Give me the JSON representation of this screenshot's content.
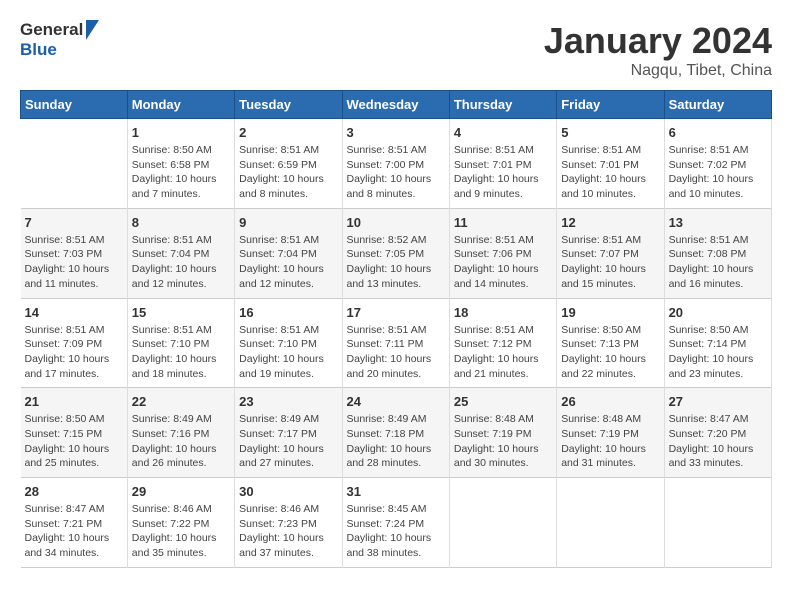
{
  "header": {
    "logo": {
      "general": "General",
      "blue": "Blue"
    },
    "title": "January 2024",
    "location": "Nagqu, Tibet, China"
  },
  "calendar": {
    "days_of_week": [
      "Sunday",
      "Monday",
      "Tuesday",
      "Wednesday",
      "Thursday",
      "Friday",
      "Saturday"
    ],
    "weeks": [
      [
        {
          "day": "",
          "info": ""
        },
        {
          "day": "1",
          "info": "Sunrise: 8:50 AM\nSunset: 6:58 PM\nDaylight: 10 hours\nand 7 minutes."
        },
        {
          "day": "2",
          "info": "Sunrise: 8:51 AM\nSunset: 6:59 PM\nDaylight: 10 hours\nand 8 minutes."
        },
        {
          "day": "3",
          "info": "Sunrise: 8:51 AM\nSunset: 7:00 PM\nDaylight: 10 hours\nand 8 minutes."
        },
        {
          "day": "4",
          "info": "Sunrise: 8:51 AM\nSunset: 7:01 PM\nDaylight: 10 hours\nand 9 minutes."
        },
        {
          "day": "5",
          "info": "Sunrise: 8:51 AM\nSunset: 7:01 PM\nDaylight: 10 hours\nand 10 minutes."
        },
        {
          "day": "6",
          "info": "Sunrise: 8:51 AM\nSunset: 7:02 PM\nDaylight: 10 hours\nand 10 minutes."
        }
      ],
      [
        {
          "day": "7",
          "info": "Sunrise: 8:51 AM\nSunset: 7:03 PM\nDaylight: 10 hours\nand 11 minutes."
        },
        {
          "day": "8",
          "info": "Sunrise: 8:51 AM\nSunset: 7:04 PM\nDaylight: 10 hours\nand 12 minutes."
        },
        {
          "day": "9",
          "info": "Sunrise: 8:51 AM\nSunset: 7:04 PM\nDaylight: 10 hours\nand 12 minutes."
        },
        {
          "day": "10",
          "info": "Sunrise: 8:52 AM\nSunset: 7:05 PM\nDaylight: 10 hours\nand 13 minutes."
        },
        {
          "day": "11",
          "info": "Sunrise: 8:51 AM\nSunset: 7:06 PM\nDaylight: 10 hours\nand 14 minutes."
        },
        {
          "day": "12",
          "info": "Sunrise: 8:51 AM\nSunset: 7:07 PM\nDaylight: 10 hours\nand 15 minutes."
        },
        {
          "day": "13",
          "info": "Sunrise: 8:51 AM\nSunset: 7:08 PM\nDaylight: 10 hours\nand 16 minutes."
        }
      ],
      [
        {
          "day": "14",
          "info": "Sunrise: 8:51 AM\nSunset: 7:09 PM\nDaylight: 10 hours\nand 17 minutes."
        },
        {
          "day": "15",
          "info": "Sunrise: 8:51 AM\nSunset: 7:10 PM\nDaylight: 10 hours\nand 18 minutes."
        },
        {
          "day": "16",
          "info": "Sunrise: 8:51 AM\nSunset: 7:10 PM\nDaylight: 10 hours\nand 19 minutes."
        },
        {
          "day": "17",
          "info": "Sunrise: 8:51 AM\nSunset: 7:11 PM\nDaylight: 10 hours\nand 20 minutes."
        },
        {
          "day": "18",
          "info": "Sunrise: 8:51 AM\nSunset: 7:12 PM\nDaylight: 10 hours\nand 21 minutes."
        },
        {
          "day": "19",
          "info": "Sunrise: 8:50 AM\nSunset: 7:13 PM\nDaylight: 10 hours\nand 22 minutes."
        },
        {
          "day": "20",
          "info": "Sunrise: 8:50 AM\nSunset: 7:14 PM\nDaylight: 10 hours\nand 23 minutes."
        }
      ],
      [
        {
          "day": "21",
          "info": "Sunrise: 8:50 AM\nSunset: 7:15 PM\nDaylight: 10 hours\nand 25 minutes."
        },
        {
          "day": "22",
          "info": "Sunrise: 8:49 AM\nSunset: 7:16 PM\nDaylight: 10 hours\nand 26 minutes."
        },
        {
          "day": "23",
          "info": "Sunrise: 8:49 AM\nSunset: 7:17 PM\nDaylight: 10 hours\nand 27 minutes."
        },
        {
          "day": "24",
          "info": "Sunrise: 8:49 AM\nSunset: 7:18 PM\nDaylight: 10 hours\nand 28 minutes."
        },
        {
          "day": "25",
          "info": "Sunrise: 8:48 AM\nSunset: 7:19 PM\nDaylight: 10 hours\nand 30 minutes."
        },
        {
          "day": "26",
          "info": "Sunrise: 8:48 AM\nSunset: 7:19 PM\nDaylight: 10 hours\nand 31 minutes."
        },
        {
          "day": "27",
          "info": "Sunrise: 8:47 AM\nSunset: 7:20 PM\nDaylight: 10 hours\nand 33 minutes."
        }
      ],
      [
        {
          "day": "28",
          "info": "Sunrise: 8:47 AM\nSunset: 7:21 PM\nDaylight: 10 hours\nand 34 minutes."
        },
        {
          "day": "29",
          "info": "Sunrise: 8:46 AM\nSunset: 7:22 PM\nDaylight: 10 hours\nand 35 minutes."
        },
        {
          "day": "30",
          "info": "Sunrise: 8:46 AM\nSunset: 7:23 PM\nDaylight: 10 hours\nand 37 minutes."
        },
        {
          "day": "31",
          "info": "Sunrise: 8:45 AM\nSunset: 7:24 PM\nDaylight: 10 hours\nand 38 minutes."
        },
        {
          "day": "",
          "info": ""
        },
        {
          "day": "",
          "info": ""
        },
        {
          "day": "",
          "info": ""
        }
      ]
    ]
  }
}
